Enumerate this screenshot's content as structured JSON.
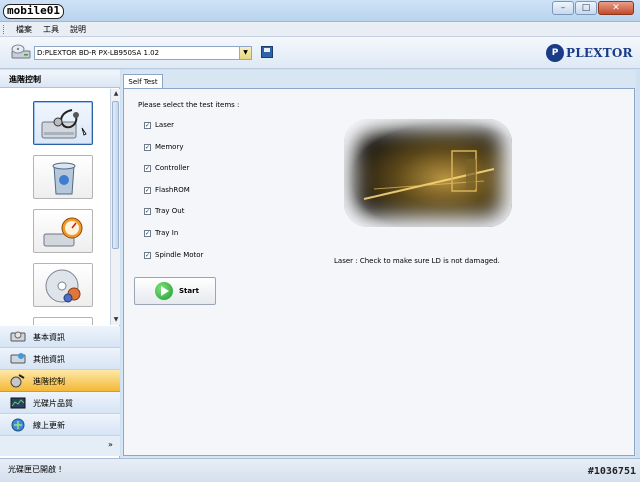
{
  "app": {
    "logo_text": "mobile01"
  },
  "window": {
    "minimize": "–",
    "maximize": "□",
    "close": "✕"
  },
  "menu": {
    "items": [
      "檔案",
      "工具",
      "說明"
    ]
  },
  "toolbar": {
    "drive_value": "D:PLEXTOR BD-R  PX-LB950SA 1.02",
    "brand": "PLEXTOR",
    "brand_badge": "P"
  },
  "left_panel": {
    "title": "進階控制"
  },
  "nav": {
    "items": [
      {
        "label": "基本資訊"
      },
      {
        "label": "其他資訊"
      },
      {
        "label": "進階控制",
        "active": true
      },
      {
        "label": "光碟片品質"
      },
      {
        "label": "線上更新"
      }
    ],
    "more": "»"
  },
  "main": {
    "tab": "Self Test",
    "prompt": "Please select the test items :",
    "check_mark": "✓",
    "items": [
      {
        "label": "Laser",
        "checked": true
      },
      {
        "label": "Memory",
        "checked": true
      },
      {
        "label": "Controller",
        "checked": true
      },
      {
        "label": "FlashROM",
        "checked": true
      },
      {
        "label": "Tray Out",
        "checked": true
      },
      {
        "label": "Tray In",
        "checked": true
      },
      {
        "label": "Spindle Motor",
        "checked": true
      }
    ],
    "description": "Laser : Check to make sure LD is not damaged.",
    "start_label": "Start"
  },
  "status": {
    "text": "光碟匣已開啟 !",
    "watermark": "#1036751"
  },
  "colors": {
    "accent": "#2b5fa8",
    "active_nav": "#f4b836",
    "brand": "#1a3c87"
  }
}
